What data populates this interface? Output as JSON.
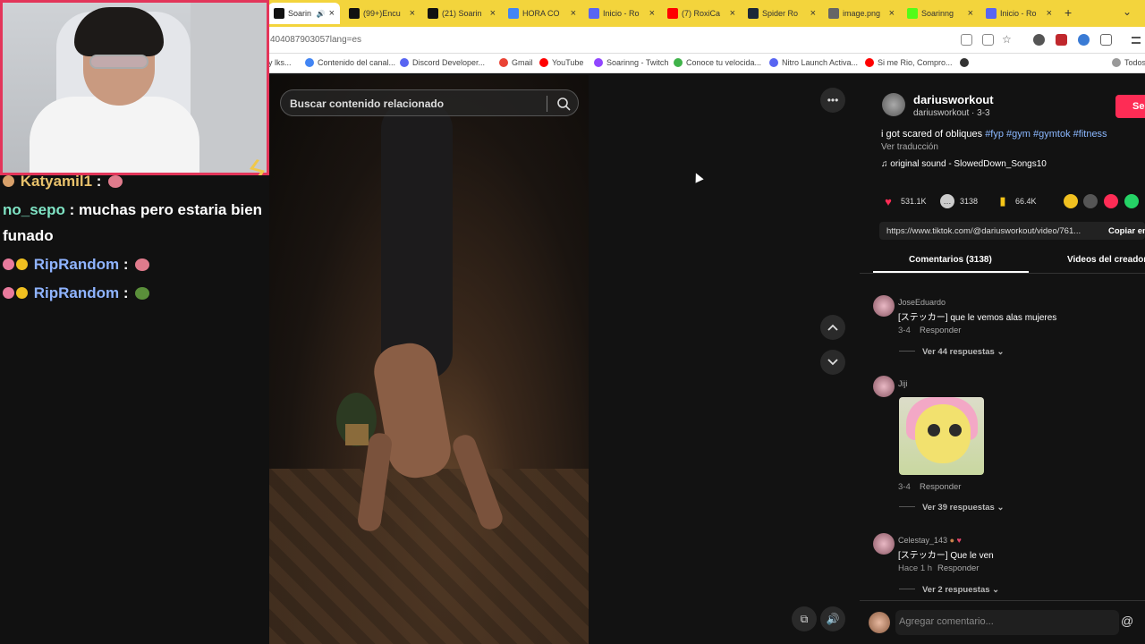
{
  "browser": {
    "tabs": [
      {
        "title": "Soarin",
        "favicon": "tiktok-icon",
        "color": "#111111",
        "active": true,
        "audio": true
      },
      {
        "title": "(99+)Encu",
        "favicon": "tiktok-icon",
        "color": "#111111"
      },
      {
        "title": "(21) Soarin",
        "favicon": "x-icon",
        "color": "#111111"
      },
      {
        "title": "HORA CO",
        "favicon": "google-icon",
        "color": "#4285f4"
      },
      {
        "title": "Inicio - Ro",
        "favicon": "page-icon",
        "color": "#5865f2"
      },
      {
        "title": "(7) RoxiCa",
        "favicon": "youtube-icon",
        "color": "#ff0000"
      },
      {
        "title": "Spider Ro",
        "favicon": "steam-icon",
        "color": "#1b2838"
      },
      {
        "title": "image.png",
        "favicon": "globe-icon",
        "color": "#666666"
      },
      {
        "title": "Soarinng",
        "favicon": "kick-icon",
        "color": "#53fc18"
      },
      {
        "title": "Inicio - Ro",
        "favicon": "page-icon",
        "color": "#5865f2"
      }
    ],
    "new_tab": "+",
    "url": "404087903057lang=es",
    "bookmarks": [
      {
        "label": "y lks...",
        "icon": "folder-icon",
        "color": "#999999"
      },
      {
        "label": "Contenido del canal...",
        "icon": "google-icon",
        "color": "#4285f4"
      },
      {
        "label": "Discord Developer...",
        "icon": "discord-icon",
        "color": "#5865f2"
      },
      {
        "label": "Gmail",
        "icon": "gmail-icon",
        "color": "#ea4335"
      },
      {
        "label": "YouTube",
        "icon": "youtube-icon",
        "color": "#ff0000"
      },
      {
        "label": "Soarinng - Twitch",
        "icon": "twitch-icon",
        "color": "#9146ff"
      },
      {
        "label": "Conoce tu velocida...",
        "icon": "speed-icon",
        "color": "#40b34a"
      },
      {
        "label": "Nitro Launch Activa...",
        "icon": "nitro-icon",
        "color": "#5865f2"
      },
      {
        "label": "Si me Rio, Compro...",
        "icon": "youtube-icon",
        "color": "#ff0000"
      },
      {
        "label": "",
        "icon": "globe-icon",
        "color": "#333333"
      },
      {
        "label": "Todos",
        "icon": "folder-icon",
        "color": "#999999"
      }
    ]
  },
  "stream_chat": {
    "messages": [
      {
        "user": "Katyamil1",
        "sep": ":",
        "text": "",
        "user_color": "#e8c16b",
        "emote_color": "#e07b8c",
        "badges": [
          "#d8a06a"
        ]
      },
      {
        "user": "no_sepo",
        "sep": ":",
        "text": "muchas pero estaria bien",
        "user_color": "#7fe3c4"
      },
      {
        "user": "",
        "sep": "",
        "text": "funado",
        "user_color": "#ffffff"
      },
      {
        "user": "RipRandom",
        "sep": ":",
        "text": "",
        "user_color": "#8fb4ff",
        "emote_color": "#e07b8c",
        "badges": [
          "#e97b9d",
          "#f0c020"
        ]
      },
      {
        "user": "RipRandom",
        "sep": ":",
        "text": "",
        "user_color": "#8fb4ff",
        "emote_color": "#5a8f3a",
        "badges": [
          "#e97b9d",
          "#f0c020"
        ]
      }
    ]
  },
  "tiktok": {
    "search_placeholder": "Buscar contenido relacionado",
    "more_icon": "•••",
    "author": {
      "name": "dariusworkout",
      "handle": "dariusworkout · 3-3",
      "follow": "Seg"
    },
    "caption_text": "i got scared of obliques ",
    "hashtags": [
      "#fyp",
      "#gym",
      "#gymtok",
      "#fitness"
    ],
    "translate": "Ver traducción",
    "sound": "original sound - SlowedDown_Songs10",
    "stats": {
      "likes": "531.1K",
      "comments": "3138",
      "saves": "66.4K"
    },
    "share_colors": [
      "#f0c020",
      "#555555",
      "#fe2c55",
      "#25d366",
      "#3b82f6"
    ],
    "link": "https://www.tiktok.com/@dariusworkout/video/761...",
    "copy": "Copiar en",
    "tabs": {
      "comments": "Comentarios (3138)",
      "creator": "Videos del creador"
    },
    "comments": [
      {
        "user": "JoseEduardo",
        "text": "[ステッカー] que le vemos alas mujeres",
        "time": "3-4",
        "reply": "Responder",
        "more": "Ver 44 respuestas ⌄"
      },
      {
        "user": "Jiji",
        "text": "",
        "time": "3-4",
        "reply": "Responder",
        "more": "Ver 39 respuestas ⌄"
      },
      {
        "user": "Celestay_143",
        "text": "[ステッカー] Que le ven",
        "time": "Hace 1 h",
        "reply": "Responder",
        "more": "Ver 2 respuestas ⌄"
      }
    ],
    "composer_placeholder": "Agregar comentario...",
    "at": "@"
  }
}
